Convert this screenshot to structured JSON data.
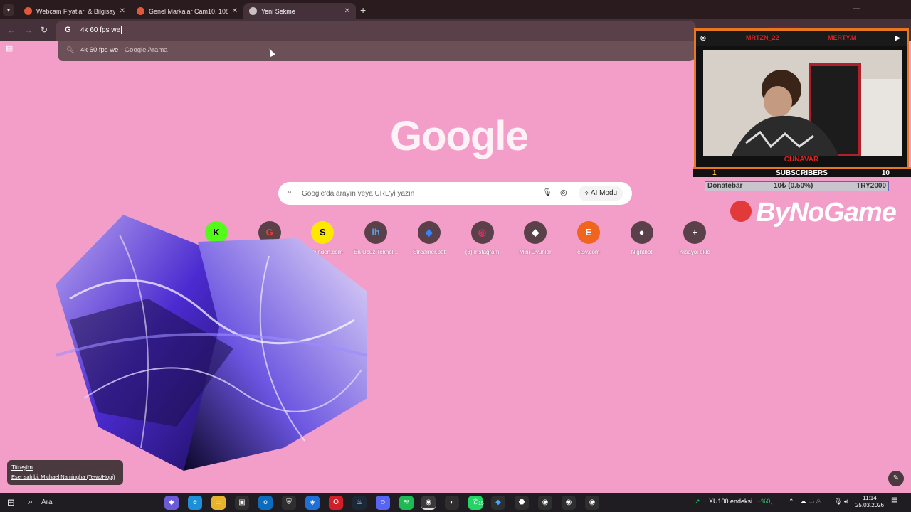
{
  "tabs": [
    {
      "title": "Webcam Fiyatları & Bilgisayar K",
      "active": false
    },
    {
      "title": "Genel Markalar Cam10, 1080p,",
      "active": false
    },
    {
      "title": "Yeni Sekme",
      "active": true
    }
  ],
  "omnibox": {
    "text": "4k 60 fps we",
    "g_icon": "G"
  },
  "suggestion": {
    "query": "4k 60 fps we",
    "suffix": " - Google Arama"
  },
  "ai_mode_top": "AI Modu",
  "google": {
    "logo": "Google",
    "search_placeholder": "Google'da arayın veya URL'yi yazın",
    "ai_mode_label": "AI Modu"
  },
  "shortcuts": [
    {
      "label": "Kick",
      "glyph": "K",
      "color": "#53fc18",
      "fg": "#000000"
    },
    {
      "label": "Google Yardım",
      "glyph": "G",
      "color": "#5a4149",
      "fg": "#ea4335"
    },
    {
      "label": "sahibinden.com",
      "glyph": "S",
      "color": "#ffe800",
      "fg": "#000000"
    },
    {
      "label": "En Ucuz Teknol...",
      "glyph": "ih",
      "color": "#5a4149",
      "fg": "#4fa3e0"
    },
    {
      "label": "Streamer.bot",
      "glyph": "◆",
      "color": "#5a4149",
      "fg": "#3b82f6"
    },
    {
      "label": "(3) Instagram",
      "glyph": "◎",
      "color": "#5a4149",
      "fg": "#e1306c"
    },
    {
      "label": "Mini Oyunlar",
      "glyph": "◆",
      "color": "#5a4149",
      "fg": "#ffffff"
    },
    {
      "label": "etsy.com",
      "glyph": "E",
      "color": "#f1641e",
      "fg": "#ffffff"
    },
    {
      "label": "Nightbot",
      "glyph": "●",
      "color": "#5a4149",
      "fg": "#ffffff"
    },
    {
      "label": "Kısayol ekle",
      "glyph": "+",
      "color": "#5a4149",
      "fg": "#ffffff"
    }
  ],
  "attribution": {
    "title": "Titreşim",
    "author": "Eser sahibi: Michael Namingha (Tewa/Hopi)"
  },
  "overlay": {
    "left_name": "MRTZN_22",
    "right_name": "MERTY.M",
    "cam_label": "CUNAVAR",
    "subs_current": "1",
    "subs_label": "SUBSCRIBERS",
    "subs_goal": "10",
    "donate_label": "Donatebar",
    "donate_progress": "10₺ (0.50%)",
    "donate_goal": "TRY2000",
    "sponsor": "ByNoGame"
  },
  "taskbar": {
    "search_label": "Ara",
    "ticker": "XU100 endeksi",
    "ticker_change": "+%0,...",
    "time": "11:14",
    "date": "25.03.2026",
    "whatsapp_badge": "15"
  }
}
